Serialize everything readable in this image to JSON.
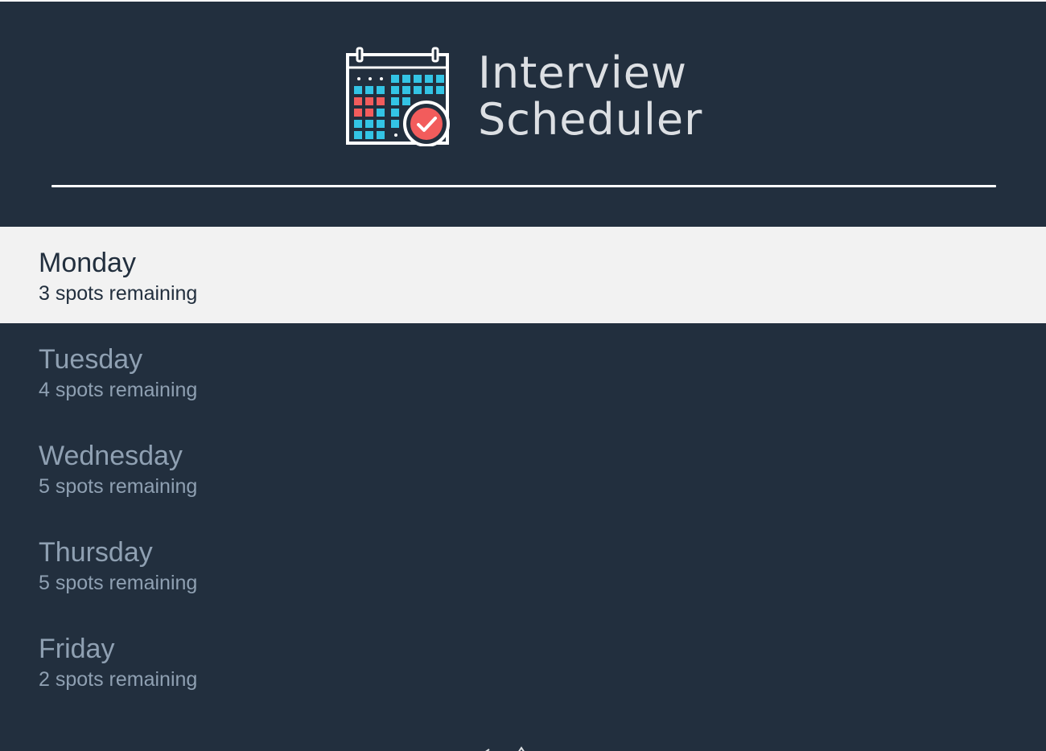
{
  "header": {
    "title_line1": "Interview",
    "title_line2": "Scheduler",
    "logo_icon": "calendar-check-icon"
  },
  "colors": {
    "background": "#222f3e",
    "selected_background": "#f2f2f2",
    "calendar_cyan": "#33c4e5",
    "calendar_red": "#f25c5c",
    "muted_text": "#8fa0b2"
  },
  "days": [
    {
      "name": "Monday",
      "spots": "3 spots remaining",
      "selected": true
    },
    {
      "name": "Tuesday",
      "spots": "4 spots remaining",
      "selected": false
    },
    {
      "name": "Wednesday",
      "spots": "5 spots remaining",
      "selected": false
    },
    {
      "name": "Thursday",
      "spots": "5 spots remaining",
      "selected": false
    },
    {
      "name": "Friday",
      "spots": "2 spots remaining",
      "selected": false
    }
  ]
}
